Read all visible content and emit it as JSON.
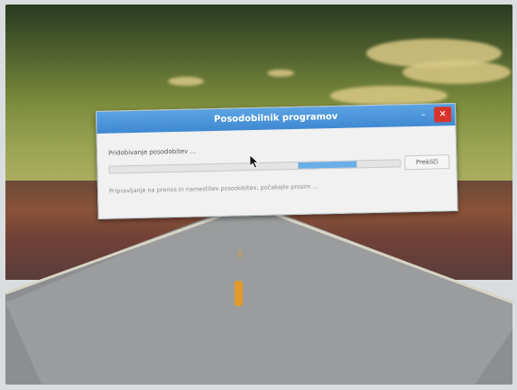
{
  "dialog": {
    "title": "Posodobilnik programov",
    "minimize_glyph": "–",
    "close_glyph": "✕",
    "status_text": "Pridobivanje posodobitev …",
    "progress": {
      "fill_start": 0.65,
      "fill_end": 0.85
    },
    "cancel_label": "Prekliči",
    "note_text": "Pripravljanje na prenos in namestitev posodobitev, počakajte prosim …"
  },
  "colors": {
    "titlebar": "#4a96da",
    "close_button": "#d9342b",
    "progress_fill": "#6aaee8"
  },
  "icons": {
    "cursor": "mouse-pointer-icon"
  }
}
